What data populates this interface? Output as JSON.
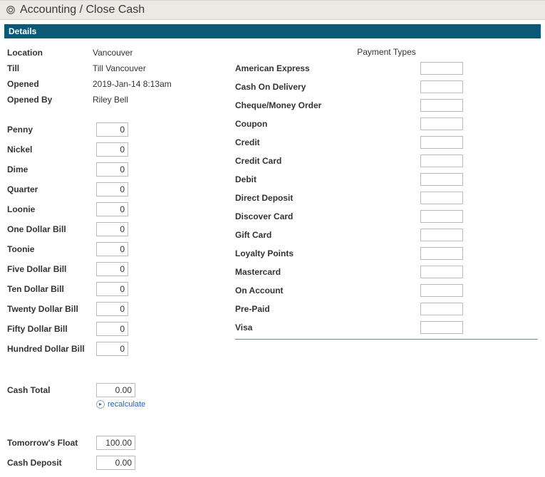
{
  "title": "Accounting / Close Cash",
  "section_header": "Details",
  "info": {
    "location_label": "Location",
    "location_value": "Vancouver",
    "till_label": "Till",
    "till_value": "Till Vancouver",
    "opened_label": "Opened",
    "opened_value": "2019-Jan-14 8:13am",
    "opened_by_label": "Opened By",
    "opened_by_value": "Riley Bell"
  },
  "denominations": [
    {
      "label": "Penny",
      "value": "0"
    },
    {
      "label": "Nickel",
      "value": "0"
    },
    {
      "label": "Dime",
      "value": "0"
    },
    {
      "label": "Quarter",
      "value": "0"
    },
    {
      "label": "Loonie",
      "value": "0"
    },
    {
      "label": "One Dollar Bill",
      "value": "0"
    },
    {
      "label": "Toonie",
      "value": "0"
    },
    {
      "label": "Five Dollar Bill",
      "value": "0"
    },
    {
      "label": "Ten Dollar Bill",
      "value": "0"
    },
    {
      "label": "Twenty Dollar Bill",
      "value": "0"
    },
    {
      "label": "Fifty Dollar Bill",
      "value": "0"
    },
    {
      "label": "Hundred Dollar Bill",
      "value": "0"
    }
  ],
  "cash_total_label": "Cash Total",
  "cash_total_value": "0.00",
  "recalculate_label": "recalculate",
  "tomorrows_float_label": "Tomorrow's Float",
  "tomorrows_float_value": "100.00",
  "cash_deposit_label": "Cash Deposit",
  "cash_deposit_value": "0.00",
  "payment_types_header": "Payment Types",
  "payment_types": [
    {
      "label": "American Express",
      "value": ""
    },
    {
      "label": "Cash On Delivery",
      "value": ""
    },
    {
      "label": "Cheque/Money Order",
      "value": ""
    },
    {
      "label": "Coupon",
      "value": ""
    },
    {
      "label": "Credit",
      "value": ""
    },
    {
      "label": "Credit Card",
      "value": ""
    },
    {
      "label": "Debit",
      "value": ""
    },
    {
      "label": "Direct Deposit",
      "value": ""
    },
    {
      "label": "Discover Card",
      "value": ""
    },
    {
      "label": "Gift Card",
      "value": ""
    },
    {
      "label": "Loyalty Points",
      "value": ""
    },
    {
      "label": "Mastercard",
      "value": ""
    },
    {
      "label": "On Account",
      "value": ""
    },
    {
      "label": "Pre-Paid",
      "value": ""
    },
    {
      "label": "Visa",
      "value": ""
    }
  ]
}
